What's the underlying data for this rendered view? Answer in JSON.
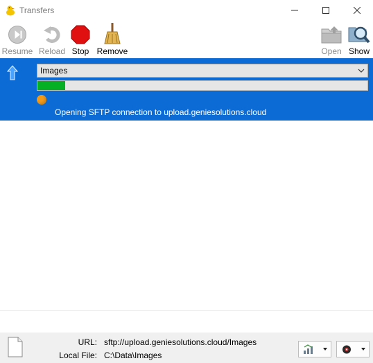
{
  "window": {
    "title": "Transfers",
    "icon": "duck-icon",
    "controls": [
      "minimize-icon",
      "maximize-icon",
      "close-icon"
    ]
  },
  "toolbar": {
    "resume_label": "Resume",
    "reload_label": "Reload",
    "stop_label": "Stop",
    "remove_label": "Remove",
    "open_label": "Open",
    "show_label": "Show"
  },
  "transfer": {
    "direction": "upload",
    "name": "Images",
    "progress": 0.085,
    "progress_color": "#06b025",
    "status_color": "#f29a1a",
    "status": "Opening SFTP connection to upload.geniesolutions.cloud",
    "selected_color": "#0c6bd4"
  },
  "footer": {
    "url_label": "URL:",
    "url_value": "sftp://upload.geniesolutions.cloud/Images",
    "local_label": "Local File:",
    "local_value": "C:\\Data\\Images",
    "bandwidth_icon": "bandwidth-icon",
    "connections_icon": "connections-icon"
  }
}
